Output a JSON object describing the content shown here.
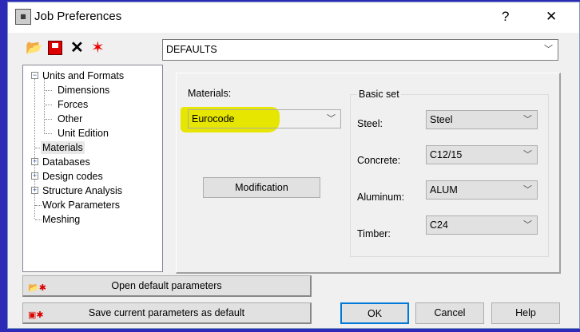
{
  "window": {
    "title": "Job Preferences",
    "help_label": "?",
    "close_label": "✕"
  },
  "toolbar": {
    "icons": [
      "open-folder-icon",
      "save-icon",
      "delete-icon",
      "reset-icon"
    ],
    "preset_value": "DEFAULTS"
  },
  "tree": {
    "items": [
      {
        "label": "Units and Formats",
        "level": 0,
        "expander": "−"
      },
      {
        "label": "Dimensions",
        "level": 1
      },
      {
        "label": "Forces",
        "level": 1
      },
      {
        "label": "Other",
        "level": 1
      },
      {
        "label": "Unit Edition",
        "level": 1
      },
      {
        "label": "Materials",
        "level": 0,
        "selected": true
      },
      {
        "label": "Databases",
        "level": 0,
        "expander": "+"
      },
      {
        "label": "Design codes",
        "level": 0,
        "expander": "+"
      },
      {
        "label": "Structure Analysis",
        "level": 0,
        "expander": "+"
      },
      {
        "label": "Work Parameters",
        "level": 0
      },
      {
        "label": "Meshing",
        "level": 0
      }
    ]
  },
  "materials": {
    "label": "Materials:",
    "value": "Eurocode",
    "highlight_color": "#e6e600",
    "modification_label": "Modification"
  },
  "basic_set": {
    "title": "Basic set",
    "rows": [
      {
        "label": "Steel:",
        "value": "Steel"
      },
      {
        "label": "Concrete:",
        "value": "C12/15"
      },
      {
        "label": "Aluminum:",
        "value": "ALUM"
      },
      {
        "label": "Timber:",
        "value": "C24"
      }
    ]
  },
  "buttons": {
    "open_default": "Open default parameters",
    "save_default": "Save current parameters as default",
    "ok": "OK",
    "cancel": "Cancel",
    "help": "Help"
  }
}
